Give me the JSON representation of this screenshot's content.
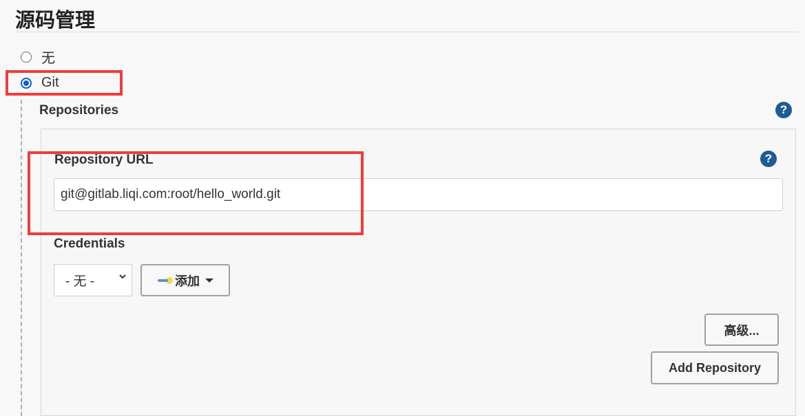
{
  "section": {
    "title": "源码管理"
  },
  "scm_options": [
    {
      "label": "无",
      "selected": false
    },
    {
      "label": "Git",
      "selected": true
    }
  ],
  "repositories": {
    "label": "Repositories",
    "help": "?",
    "url": {
      "label": "Repository URL",
      "value": "git@gitlab.liqi.com:root/hello_world.git",
      "help": "?"
    },
    "credentials": {
      "label": "Credentials",
      "selected": "- 无 -",
      "add_button": "添加"
    },
    "advanced_button": "高级...",
    "add_repository_button": "Add Repository"
  },
  "colors": {
    "highlight": "#f23b3b",
    "accent": "#0b5ed7",
    "help": "#1d5c94"
  },
  "icons": {
    "help": "help-icon",
    "key": "key-icon",
    "dropdown": "chevron-down-icon"
  }
}
